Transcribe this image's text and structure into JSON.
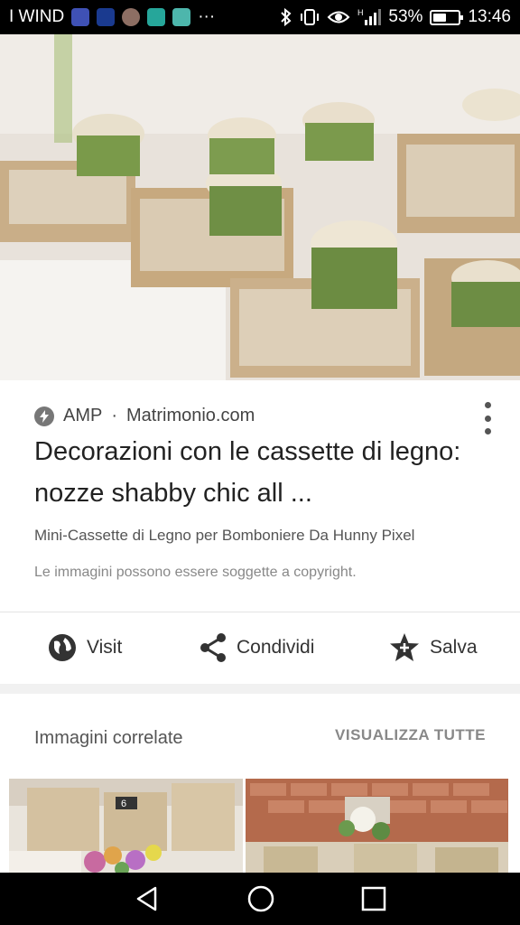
{
  "status_bar": {
    "carrier": "I WIND",
    "overflow": "···",
    "battery_percent": "53%",
    "battery_level": 0.53,
    "time": "13:46",
    "icons": [
      "bluetooth-icon",
      "vibrate-icon",
      "eye-icon",
      "signal-icon",
      "battery-icon"
    ]
  },
  "hero": {
    "image": "wooden-crate-favors-photo"
  },
  "result": {
    "source_prefix": "AMP",
    "source_separator": "·",
    "source_site": "Matrimonio.com",
    "title": "Decorazioni con le cassette di legno: nozze shabby chic all ...",
    "subtitle": "Mini-Cassette di Legno per Bomboniere Da Hunny Pixel",
    "copyright": "Le immagini possono essere soggette a copyright."
  },
  "actions": {
    "visit": "Visit",
    "share": "Condividi",
    "save": "Salva"
  },
  "related": {
    "title": "Immagini correlate",
    "view_all": "VISUALIZZA TUTTE",
    "thumbs": [
      "related-image-1",
      "related-image-2"
    ],
    "thumb_badge": "6"
  },
  "colors": {
    "accent_text": "#222222",
    "muted": "#888888"
  }
}
